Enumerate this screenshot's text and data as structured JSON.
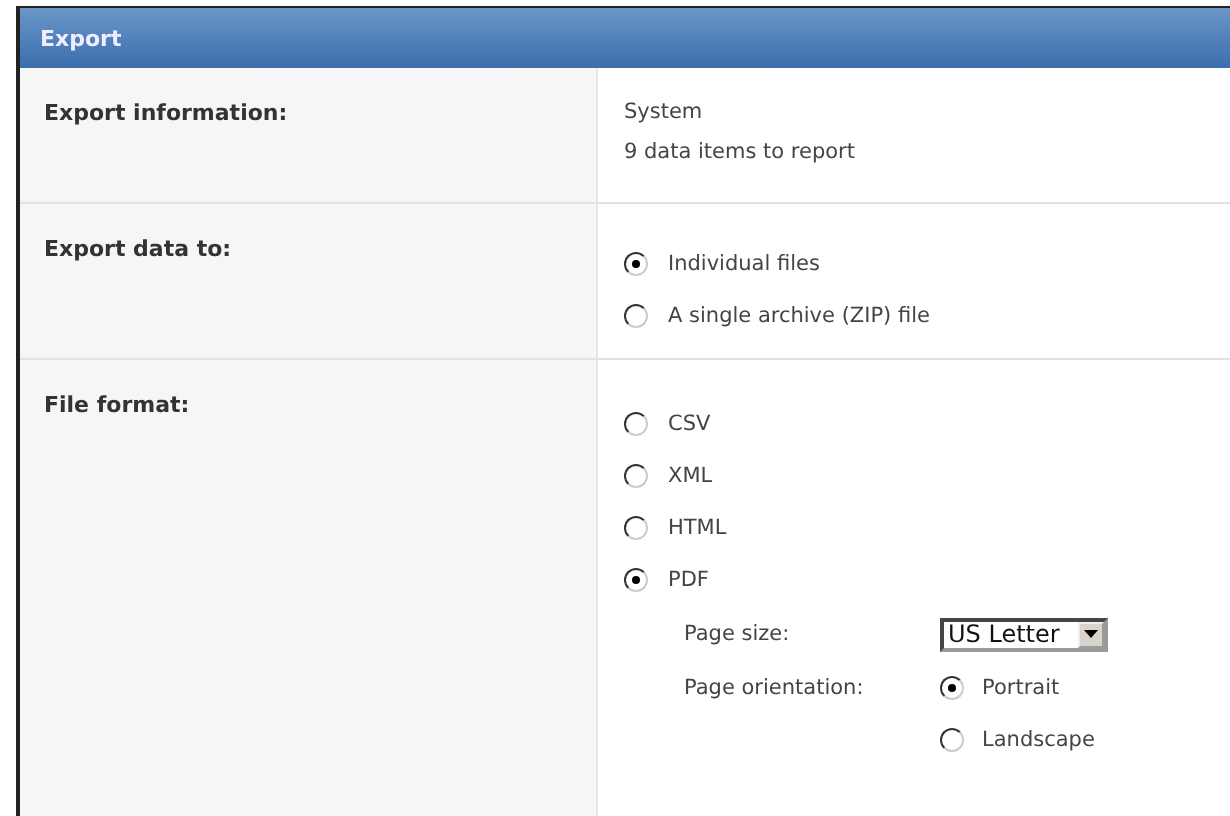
{
  "header": {
    "title": "Export"
  },
  "info": {
    "label": "Export information:",
    "lines": [
      "System",
      "9 data items to report"
    ]
  },
  "destination": {
    "label": "Export data to:",
    "options": [
      {
        "label": "Individual files",
        "selected": true
      },
      {
        "label": "A single archive (ZIP) file",
        "selected": false
      }
    ]
  },
  "format": {
    "label": "File format:",
    "options": [
      {
        "label": "CSV",
        "selected": false
      },
      {
        "label": "XML",
        "selected": false
      },
      {
        "label": "HTML",
        "selected": false
      },
      {
        "label": "PDF",
        "selected": true
      }
    ],
    "page_size": {
      "label": "Page size:",
      "value": "US Letter"
    },
    "page_orientation": {
      "label": "Page orientation:",
      "options": [
        {
          "label": "Portrait",
          "selected": true
        },
        {
          "label": "Landscape",
          "selected": false
        }
      ]
    }
  }
}
